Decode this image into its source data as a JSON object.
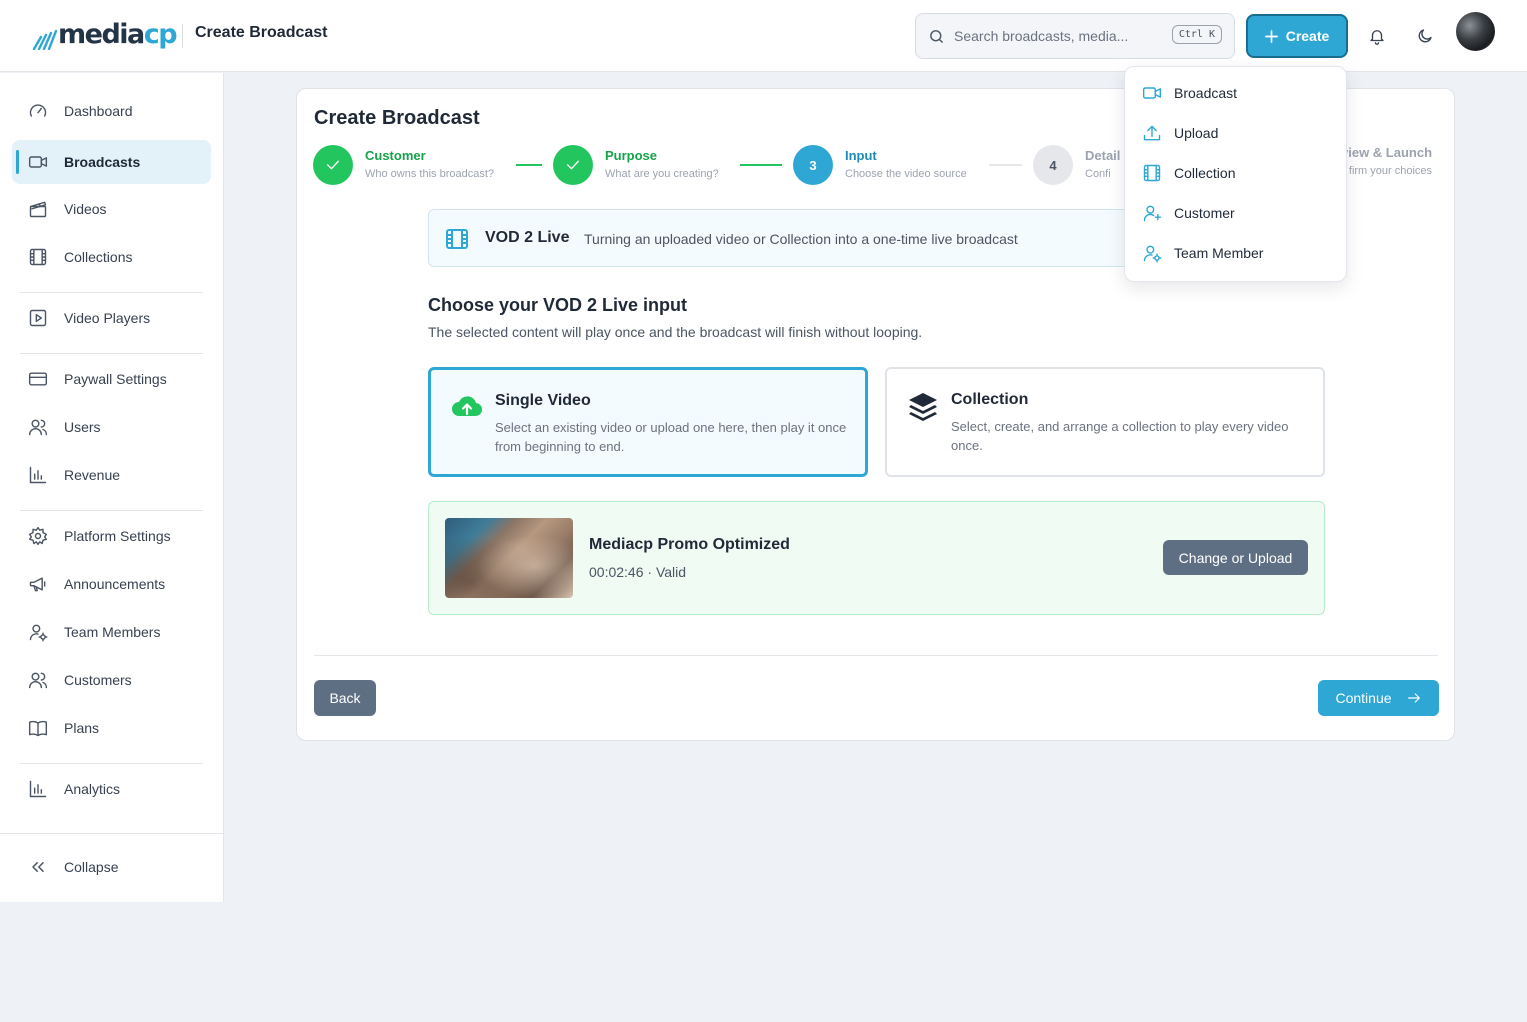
{
  "header": {
    "logo": {
      "part1": "media",
      "part2": "cp"
    },
    "page_title": "Create Broadcast",
    "search_placeholder": "Search broadcasts, media...",
    "search_shortcut": "Ctrl K",
    "create_label": "Create"
  },
  "sidebar": {
    "items": [
      {
        "label": "Dashboard",
        "icon": "gauge-icon"
      },
      {
        "label": "Broadcasts",
        "icon": "video-camera-icon",
        "active": true
      },
      {
        "label": "Videos",
        "icon": "clapperboard-icon"
      },
      {
        "label": "Collections",
        "icon": "film-icon"
      },
      {
        "label": "Video Players",
        "icon": "play-square-icon"
      },
      {
        "label": "Paywall Settings",
        "icon": "credit-card-icon"
      },
      {
        "label": "Users",
        "icon": "users-icon"
      },
      {
        "label": "Revenue",
        "icon": "bar-chart-icon"
      },
      {
        "label": "Platform Settings",
        "icon": "gear-icon"
      },
      {
        "label": "Announcements",
        "icon": "megaphone-icon"
      },
      {
        "label": "Team Members",
        "icon": "user-cog-icon"
      },
      {
        "label": "Customers",
        "icon": "users-icon"
      },
      {
        "label": "Plans",
        "icon": "book-icon"
      },
      {
        "label": "Analytics",
        "icon": "bar-chart-icon"
      }
    ],
    "collapse_label": "Collapse"
  },
  "main": {
    "title": "Create Broadcast",
    "steps": [
      {
        "number": "1",
        "label": "Customer",
        "sub": "Who owns this broadcast?",
        "state": "done"
      },
      {
        "number": "2",
        "label": "Purpose",
        "sub": "What are you creating?",
        "state": "done"
      },
      {
        "number": "3",
        "label": "Input",
        "sub": "Choose the video source",
        "state": "current"
      },
      {
        "number": "4",
        "label": "Detail",
        "sub": "Confi",
        "state": "todo"
      },
      {
        "number": "5",
        "label": "view & Launch",
        "sub": "firm your choices",
        "state": "todo"
      }
    ],
    "mode": {
      "title": "VOD 2 Live",
      "description": "Turning an uploaded video or Collection into a one-time live broadcast"
    },
    "section_title": "Choose your VOD 2 Live input",
    "section_subtitle": "The selected content will play once and the broadcast will finish without looping.",
    "options": [
      {
        "title": "Single Video",
        "description": "Select an existing video or upload one here, then play it once from beginning to end.",
        "selected": true
      },
      {
        "title": "Collection",
        "description": "Select, create, and arrange a collection to play every video once.",
        "selected": false
      }
    ],
    "selected_media": {
      "title": "Mediacp Promo Optimized",
      "meta": "00:02:46 · Valid",
      "button": "Change or Upload"
    },
    "back_label": "Back",
    "continue_label": "Continue"
  },
  "create_menu": {
    "items": [
      {
        "label": "Broadcast",
        "icon": "video-camera-icon"
      },
      {
        "label": "Upload",
        "icon": "upload-icon"
      },
      {
        "label": "Collection",
        "icon": "film-icon"
      },
      {
        "label": "Customer",
        "icon": "user-plus-icon"
      },
      {
        "label": "Team Member",
        "icon": "user-cog-icon"
      }
    ]
  },
  "colors": {
    "accent": "#2ea7d4",
    "success": "#22c55e",
    "muted_button": "#5f6f83"
  }
}
